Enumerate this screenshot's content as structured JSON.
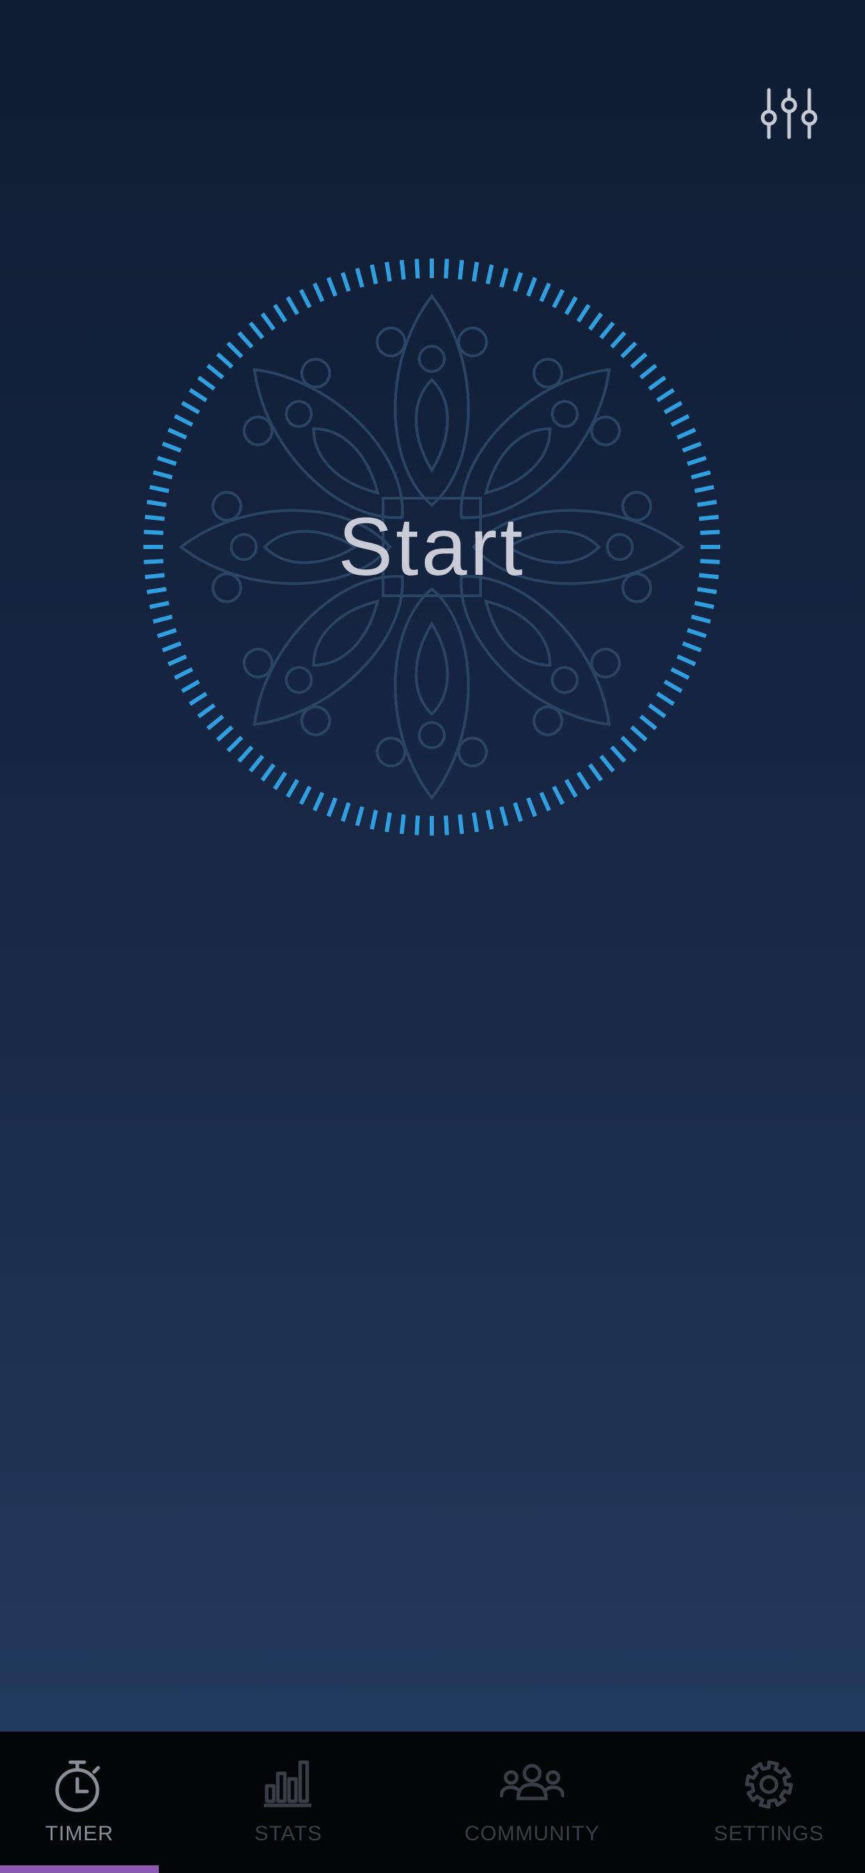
{
  "main": {
    "start_label": "Start",
    "adjust_icon": "sliders-icon",
    "ring_color": "#2e9fe0",
    "mandala_color": "#2a4564"
  },
  "tabbar": {
    "active_color": "#8b5ab0",
    "tabs": [
      {
        "label": "TIMER",
        "icon": "stopwatch-icon",
        "active": true
      },
      {
        "label": "STATS",
        "icon": "bar-chart-icon",
        "active": false
      },
      {
        "label": "COMMUNITY",
        "icon": "people-icon",
        "active": false
      },
      {
        "label": "SETTINGS",
        "icon": "gear-icon",
        "active": false
      }
    ]
  }
}
